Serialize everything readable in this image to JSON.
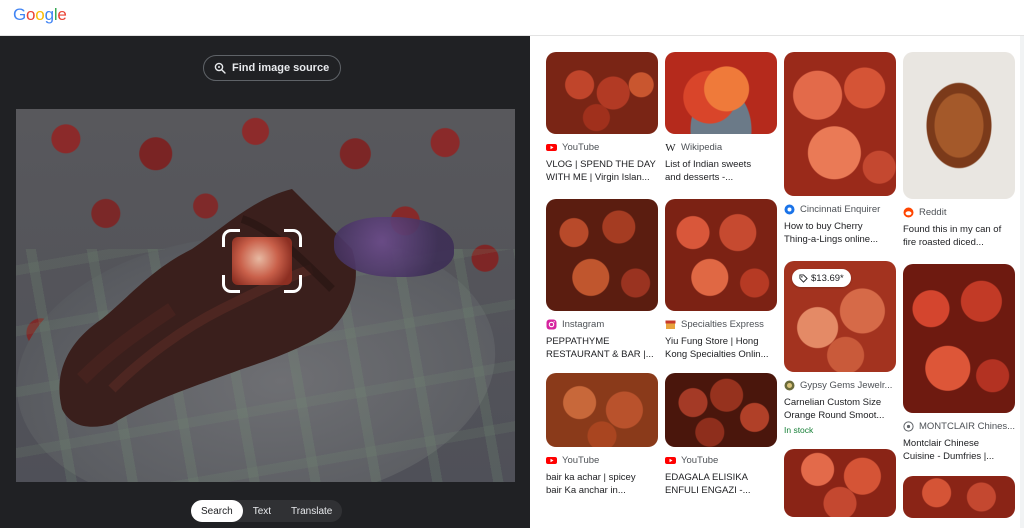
{
  "header": {
    "logo": "Google"
  },
  "left": {
    "find_source_label": "Find image source",
    "modes": [
      "Search",
      "Text",
      "Translate"
    ],
    "active_mode": "Search"
  },
  "results": [
    {
      "source": "YouTube",
      "icon": "youtube-icon",
      "title1": "VLOG | SPEND THE DAY",
      "title2": "WITH ME | Virgin Islan..."
    },
    {
      "source": "Wikipedia",
      "icon": "wikipedia-icon",
      "title1": "List of Indian sweets",
      "title2": "and desserts -..."
    },
    {
      "source": "Cincinnati Enquirer",
      "icon": "cincinnati-enquirer-icon",
      "title1": "How to buy Cherry",
      "title2": "Thing-a-Lings online..."
    },
    {
      "source": "Reddit",
      "icon": "reddit-icon",
      "title1": "Found this in my can of",
      "title2": "fire roasted diced..."
    },
    {
      "source": "Instagram",
      "icon": "instagram-icon",
      "title1": "PEPPATHYME",
      "title2": "RESTAURANT & BAR |..."
    },
    {
      "source": "Specialties Express",
      "icon": "store-icon",
      "title1": "Yiu Fung Store | Hong",
      "title2": "Kong Specialties Onlin..."
    },
    {
      "source": "Gypsy Gems Jewelr...",
      "icon": "gypsy-gems-icon",
      "title1": "Carnelian Custom Size",
      "title2": "Orange Round Smoot...",
      "price": "$13.69*",
      "stock": "In stock"
    },
    {
      "source": "MONTCLAIR Chines...",
      "icon": "montclair-icon",
      "title1": "Montclair Chinese",
      "title2": "Cuisine - Dumfries |..."
    },
    {
      "source": "YouTube",
      "icon": "youtube-icon",
      "title1": "bair ka achar | spicey",
      "title2": "bair Ka anchar in..."
    },
    {
      "source": "YouTube",
      "icon": "youtube-icon",
      "title1": "EDAGALA ELISIKA",
      "title2": "ENFULI ENGAZI -..."
    }
  ],
  "colors": {
    "google_blue": "#4285F4",
    "google_red": "#EA4335",
    "google_yellow": "#FBBC05",
    "google_green": "#34A853",
    "dark_bg": "#202124",
    "stock_green": "#188038"
  }
}
